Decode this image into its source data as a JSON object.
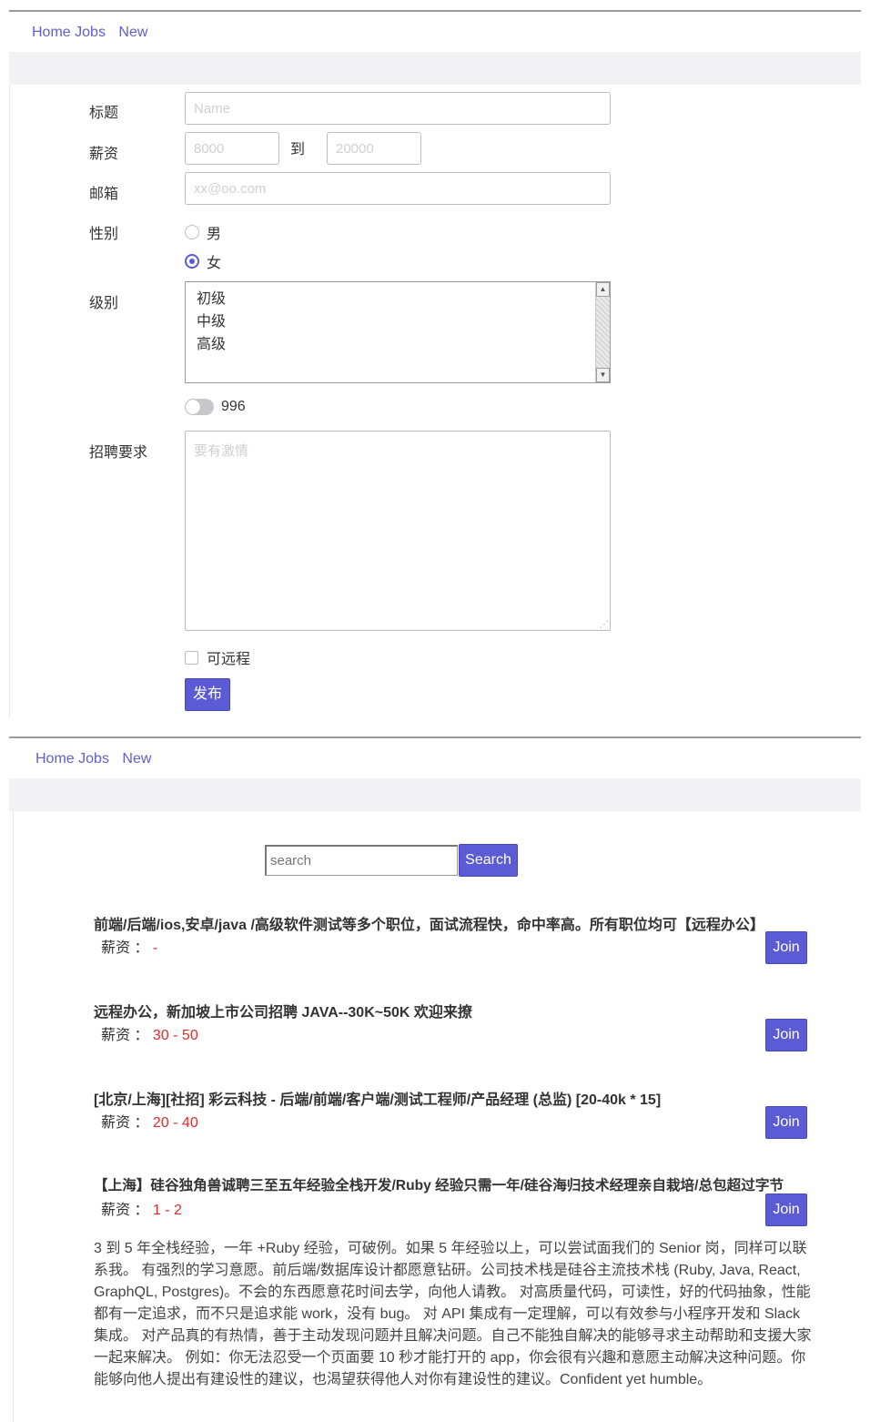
{
  "nav": {
    "home": "Home",
    "jobs": "Jobs",
    "new": "New"
  },
  "form": {
    "title_label": "标题",
    "title_placeholder": "Name",
    "salary_label": "薪资",
    "salary_min_placeholder": "8000",
    "salary_to": "到",
    "salary_max_placeholder": "20000",
    "email_label": "邮箱",
    "email_placeholder": "xx@oo.com",
    "gender_label": "性别",
    "gender_options": [
      "男",
      "女"
    ],
    "gender_selected": "女",
    "level_label": "级别",
    "level_options": [
      "初级",
      "中级",
      "高级"
    ],
    "toggle_label": "996",
    "toggle_on": false,
    "requirements_label": "招聘要求",
    "requirements_placeholder": "要有激情",
    "remote_label": "可远程",
    "remote_checked": false,
    "submit_label": "发布"
  },
  "listing": {
    "search_placeholder": "search",
    "search_button": "Search",
    "salary_label": "薪资 ：",
    "join_label": "Join",
    "jobs": [
      {
        "title": "前端/后端/ios,安卓/java /高级软件测试等多个职位，面试流程快，命中率高。所有职位均可【远程办公】",
        "salary": "-"
      },
      {
        "title": "远程办公，新加坡上市公司招聘 JAVA--30K~50K 欢迎来撩",
        "salary": "30 - 50"
      },
      {
        "title": "[北京/上海][社招] 彩云科技 - 后端/前端/客户端/测试工程师/产品经理 (总监) [20-40k * 15]",
        "salary": "20 - 40"
      },
      {
        "title": "【上海】硅谷独角兽诚聘三至五年经验全栈开发/Ruby 经验只需一年/硅谷海归技术经理亲自栽培/总包超过字节",
        "salary": "1 - 2"
      }
    ],
    "description": "3 到 5 年全栈经验，一年 +Ruby 经验，可破例。如果 5 年经验以上，可以尝试面我们的 Senior 岗，同样可以联系我。 有强烈的学习意愿。前后端/数据库设计都愿意钻研。公司技术栈是硅谷主流技术栈 (Ruby, Java, React, GraphQL, Postgres)。不会的东西愿意花时间去学，向他人请教。 对高质量代码，可读性，好的代码抽象，性能都有一定追求，而不只是追求能 work，没有 bug。 对 API 集成有一定理解，可以有效参与小程序开发和 Slack 集成。 对产品真的有热情，善于主动发现问题并且解决问题。自己不能独自解决的能够寻求主动帮助和支援大家一起来解决。 例如：你无法忍受一个页面要 10 秒才能打开的 app，你会很有兴趣和意愿主动解决这种问题。你能够向他人提出有建设性的建议，也渴望获得他人对你有建设性的建议。Confident yet humble。"
  },
  "colors": {
    "accent": "#5b5bd6",
    "link": "#5f5fd0",
    "salary": "#e02b2b"
  }
}
